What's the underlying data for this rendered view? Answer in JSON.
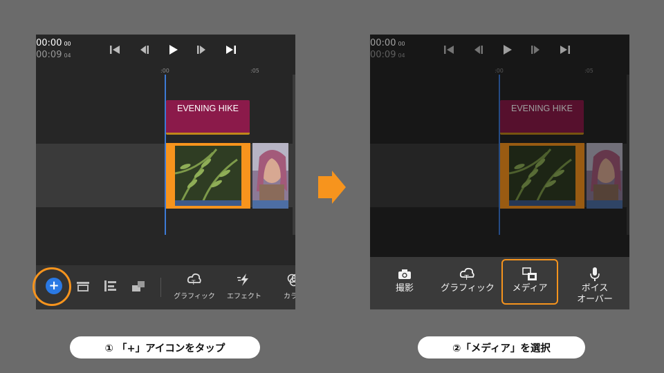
{
  "panel1": {
    "timecode_current": "00:00",
    "timecode_current_frames": "00",
    "timecode_total": "00:09",
    "timecode_total_frames": "04",
    "ruler_start": ":00",
    "ruler_mark": ":05",
    "title_clip_text": "EVENING HIKE",
    "add_button_label": "+",
    "tools": [
      {
        "icon": "graphics-icon",
        "label": "グラフィック"
      },
      {
        "icon": "effects-icon",
        "label": "エフェクト"
      },
      {
        "icon": "color-icon",
        "label": "カラー"
      }
    ]
  },
  "panel2": {
    "timecode_current": "00:00",
    "timecode_current_frames": "00",
    "timecode_total": "00:09",
    "timecode_total_frames": "04",
    "ruler_start": ":00",
    "ruler_mark": ":05",
    "title_clip_text": "EVENING HIKE",
    "menu": [
      {
        "icon": "camera-icon",
        "label": "撮影"
      },
      {
        "icon": "graphics-icon",
        "label": "グラフィック"
      },
      {
        "icon": "media-icon",
        "label": "メディア"
      },
      {
        "icon": "microphone-icon",
        "label_line1": "ボイス",
        "label_line2": "オーバー"
      }
    ]
  },
  "captions": {
    "step1": "① 「+」アイコンをタップ",
    "step2": "②「メディア」を選択"
  },
  "colors": {
    "highlight": "#f7941d",
    "accent_blue": "#2a79e4",
    "title_clip": "#8b1a4a"
  }
}
